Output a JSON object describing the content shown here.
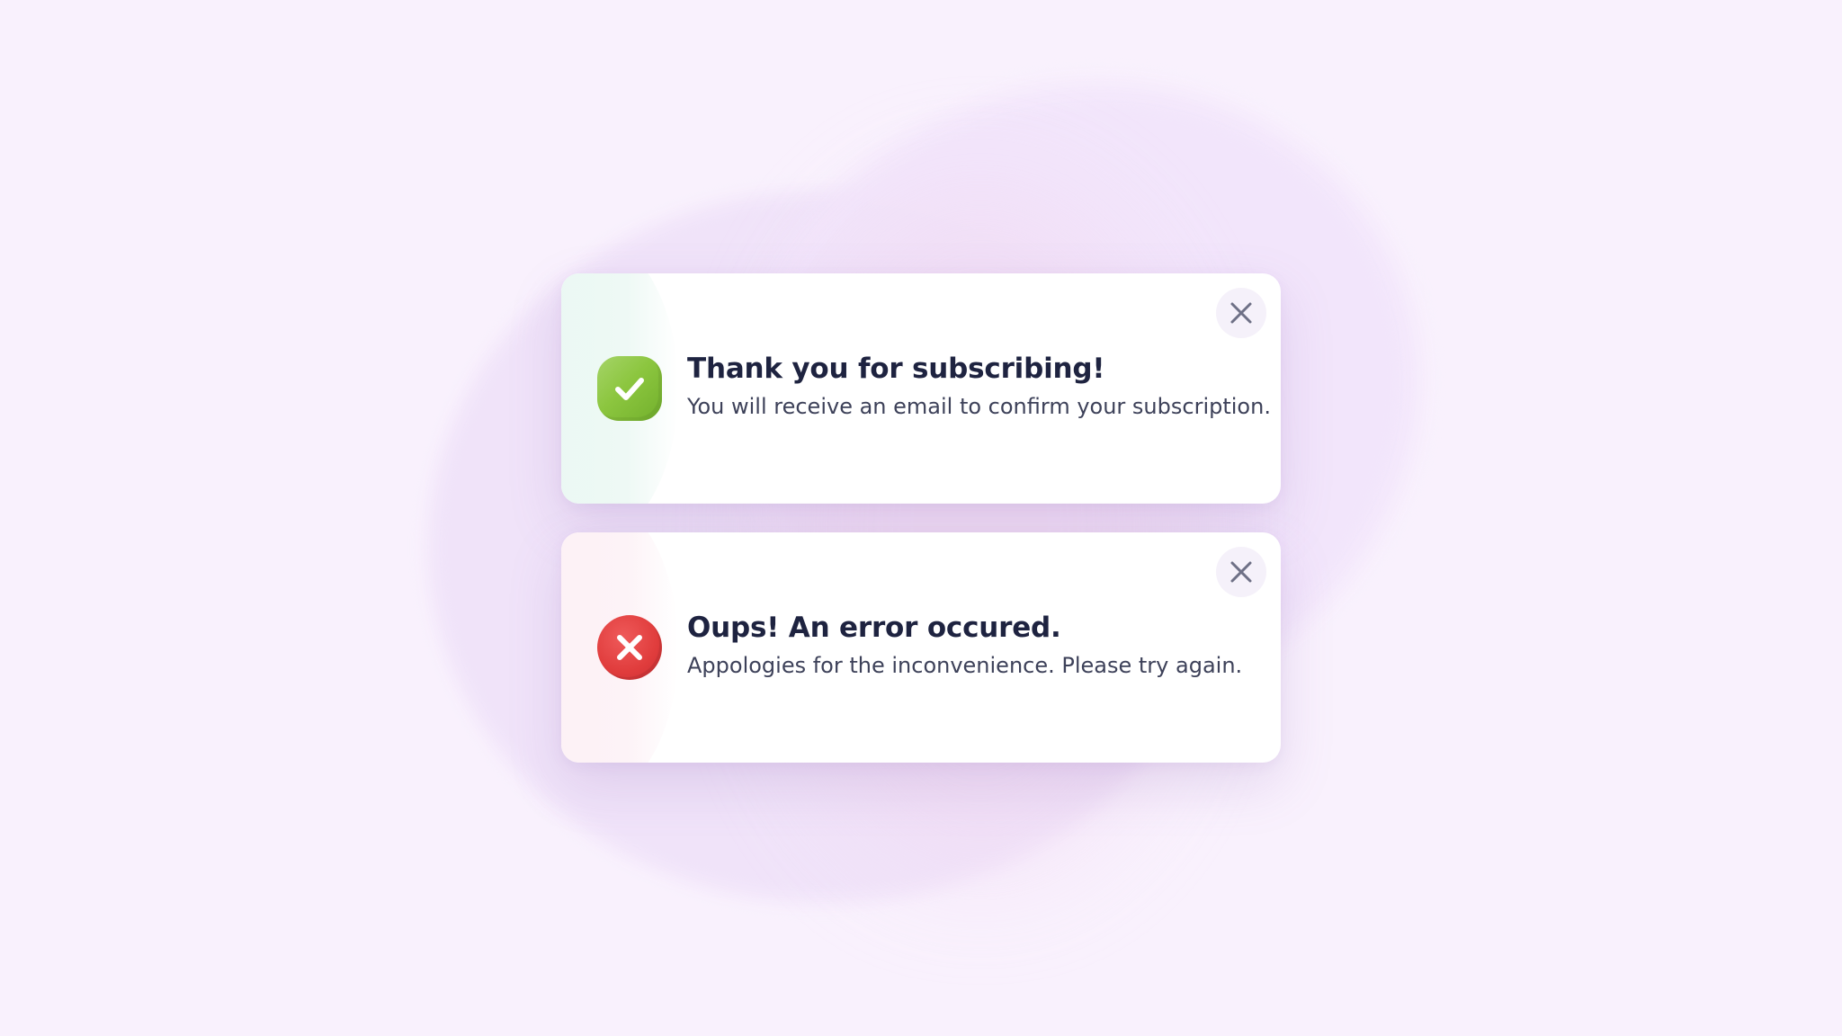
{
  "colors": {
    "background": "#f9f1fd",
    "success_accent": "#8cc63f",
    "error_accent": "#e03c3c",
    "title_text": "#1e2340",
    "message_text": "#3d4159",
    "close_icon": "#6e7086"
  },
  "toasts": [
    {
      "type": "success",
      "icon": "check-icon",
      "title": "Thank you for subscribing!",
      "message": "You will receive an email to confirm your subscription.",
      "close_icon": "close-icon"
    },
    {
      "type": "error",
      "icon": "cross-icon",
      "title": "Oups! An error occured.",
      "message": "Appologies for the inconvenience. Please try again.",
      "close_icon": "close-icon"
    }
  ]
}
